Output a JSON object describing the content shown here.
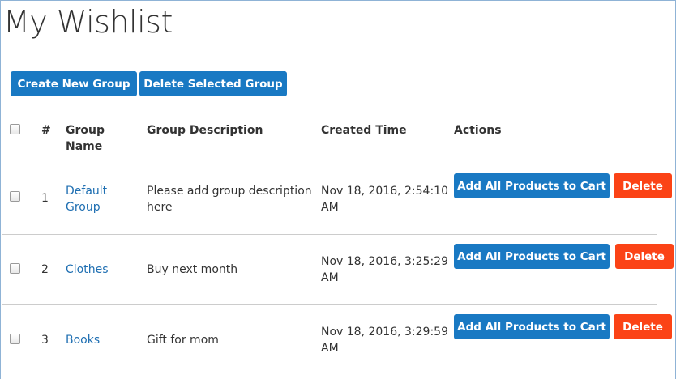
{
  "page": {
    "title": "My Wishlist"
  },
  "toolbar": {
    "create_label": "Create New Group",
    "delete_selected_label": "Delete Selected Group"
  },
  "table": {
    "headers": {
      "number": "#",
      "group_name_line1": "Group",
      "group_name_line2": "Name",
      "description": "Group Description",
      "created": "Created Time",
      "actions": "Actions"
    },
    "rows": [
      {
        "index": "1",
        "name_line1": "Default",
        "name_line2": "Group",
        "description_line1": "Please add group description",
        "description_line2": "here",
        "created_line1": "Nov 18, 2016, 2:54:10",
        "created_line2": "AM",
        "add_label": "Add All Products to Cart",
        "delete_label": "Delete"
      },
      {
        "index": "2",
        "name_line1": "Clothes",
        "description_line1": "Buy next month",
        "created_line1": "Nov 18, 2016, 3:25:29",
        "created_line2": "AM",
        "add_label": "Add All Products to Cart",
        "delete_label": "Delete"
      },
      {
        "index": "3",
        "name_line1": "Books",
        "description_line1": "Gift for mom",
        "created_line1": "Nov 18, 2016, 3:29:59",
        "created_line2": "AM",
        "add_label": "Add All Products to Cart",
        "delete_label": "Delete"
      }
    ]
  },
  "colors": {
    "primary": "#1979c3",
    "danger": "#fb4316",
    "link": "#1f6fb2"
  }
}
